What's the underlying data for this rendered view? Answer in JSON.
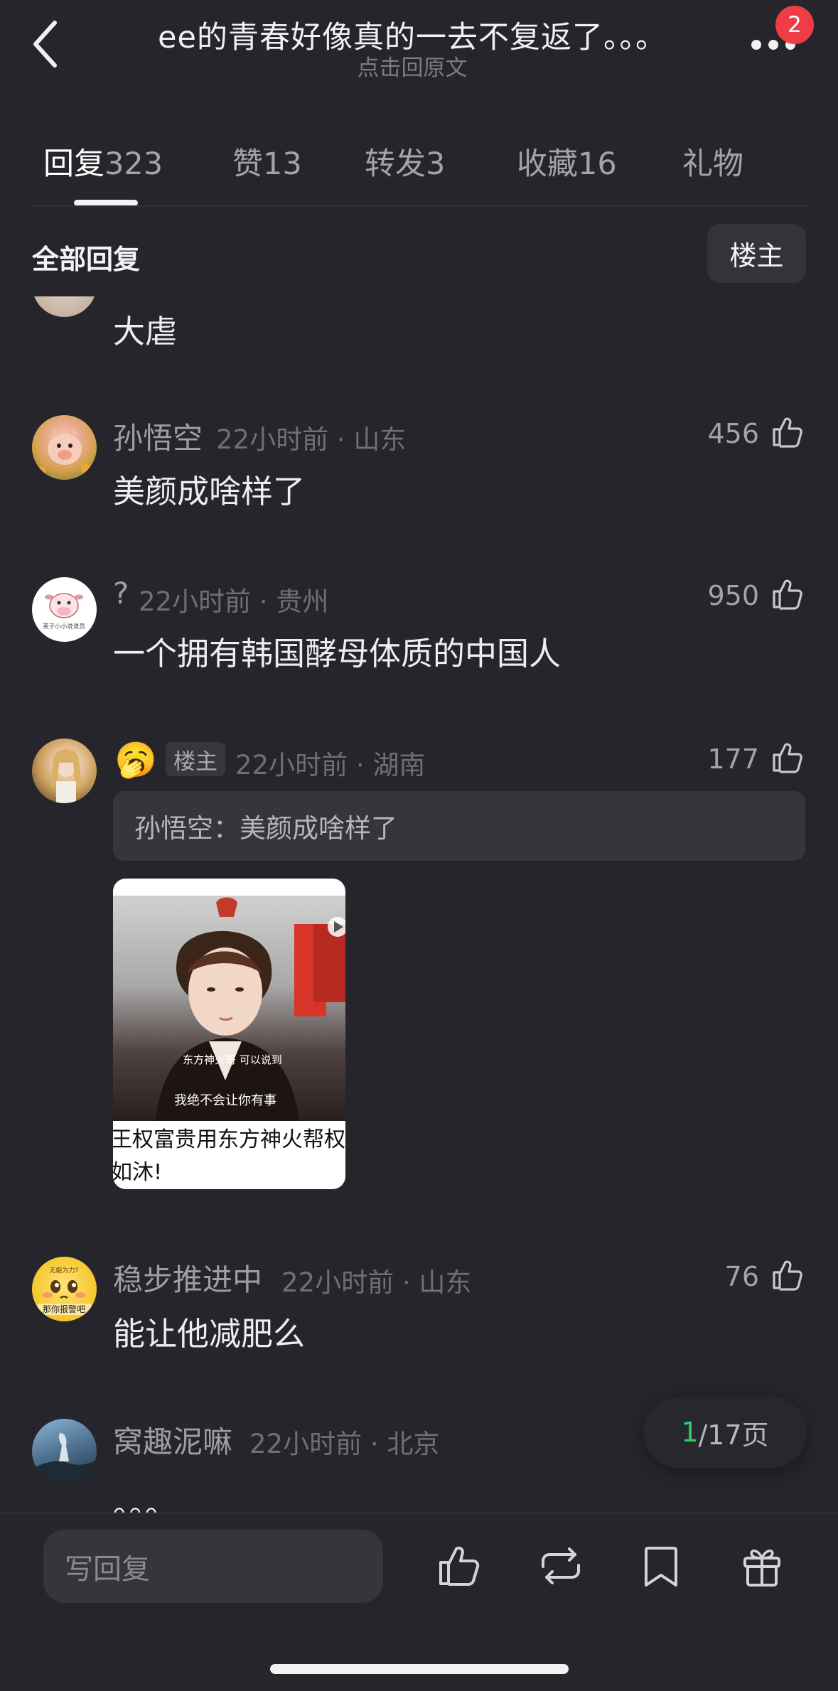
{
  "header": {
    "title": "ee的青春好像真的一去不复返了。。。",
    "subtitle": "点击回原文",
    "notification_count": "2"
  },
  "tabs": [
    {
      "label": "回复",
      "count": "323",
      "active": true
    },
    {
      "label": "赞",
      "count": "13"
    },
    {
      "label": "转发",
      "count": "3"
    },
    {
      "label": "收藏",
      "count": "16"
    },
    {
      "label": "礼物",
      "count": ""
    }
  ],
  "filter": {
    "all_replies_label": "全部回复",
    "op_only_label": "楼主"
  },
  "comments": [
    {
      "text": "大虐"
    },
    {
      "username": "孙悟空",
      "meta": "22小时前 · 山东",
      "likes": "456",
      "text": "美颜成啥样了"
    },
    {
      "username": "?",
      "meta": "22小时前 · 贵州",
      "likes": "950",
      "text": "一个拥有韩国酵母体质的中国人",
      "avatar_caption": "芙子小小说说员"
    },
    {
      "username_emoji": "🥱",
      "op_tag": "楼主",
      "meta": "22小时前 · 湖南",
      "likes": "177",
      "quote": "孙悟空：美颜成啥样了",
      "video": {
        "caption_line1": "东方神火哥 可以说到",
        "caption_line2": "我绝不会让你有事",
        "title": "王权富贵用东方神火帮权如沐!"
      }
    },
    {
      "username": "稳步推进中",
      "meta": "22小时前 · 山东",
      "likes": "76",
      "text": "能让他减肥么",
      "avatar_caption_top": "无能为力?",
      "avatar_caption_bottom": "那你报警吧"
    },
    {
      "username": "窝趣泥嘛",
      "meta": "22小时前 · 北京",
      "text": "。。。"
    }
  ],
  "pager": {
    "current": "1",
    "total_text": "/17页"
  },
  "bottom_bar": {
    "reply_placeholder": "写回复"
  },
  "colors": {
    "background": "#25252b",
    "accent_green": "#2fcf6a",
    "badge_red": "#ef3d45"
  }
}
